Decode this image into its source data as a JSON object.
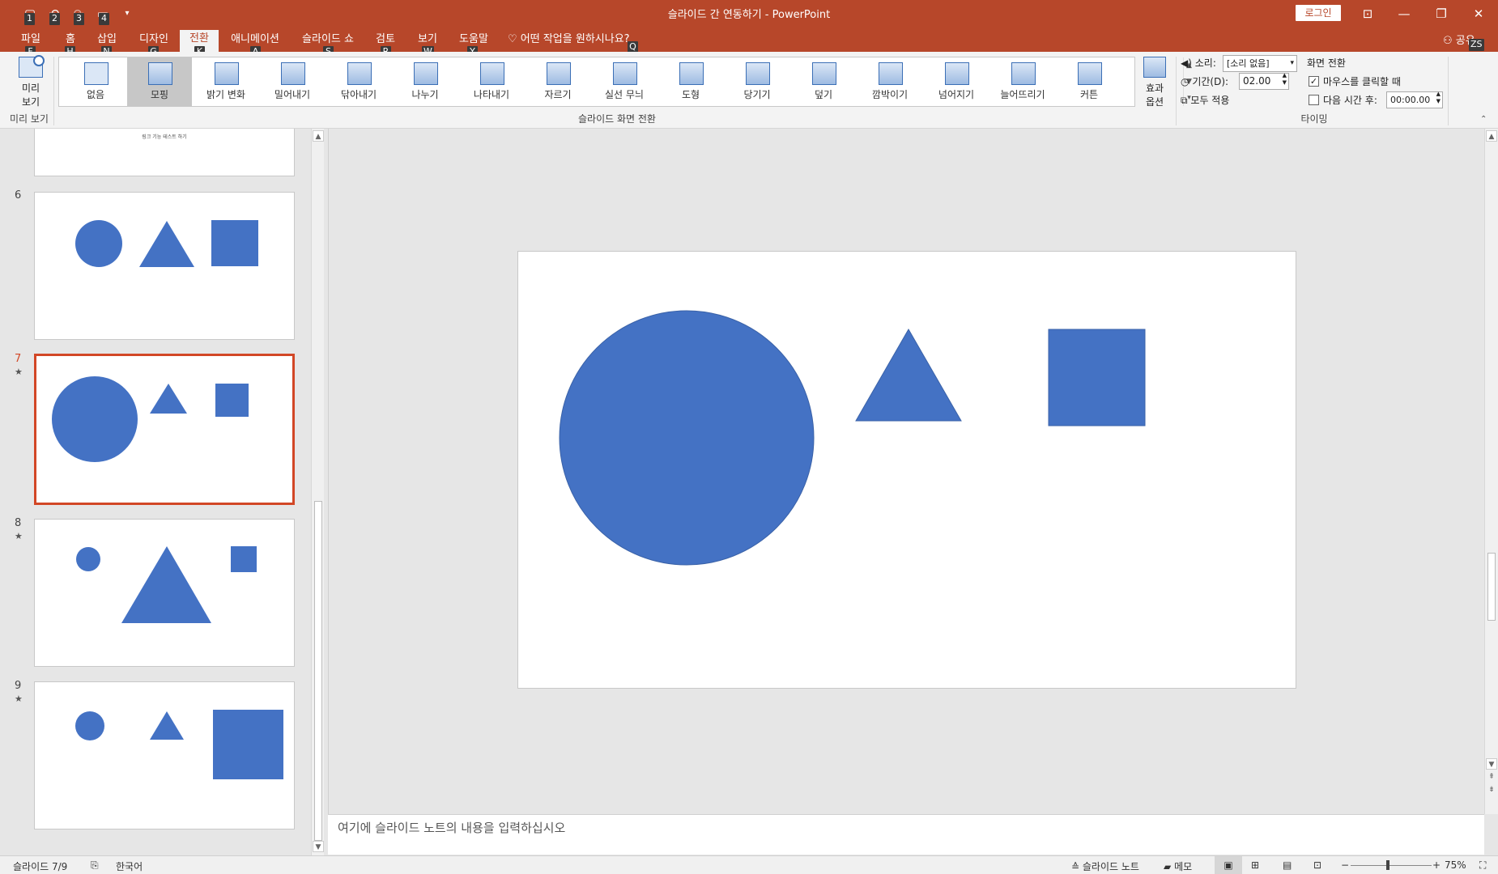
{
  "window": {
    "title": "슬라이드 간 연동하기 - PowerPoint",
    "login": "로그인"
  },
  "qat": {
    "keytips": [
      "1",
      "2",
      "3",
      "4"
    ]
  },
  "tabs": [
    {
      "label": "파일",
      "key": "F"
    },
    {
      "label": "홈",
      "key": "H"
    },
    {
      "label": "삽입",
      "key": "N"
    },
    {
      "label": "디자인",
      "key": "G"
    },
    {
      "label": "전환",
      "key": "K"
    },
    {
      "label": "애니메이션",
      "key": "A"
    },
    {
      "label": "슬라이드 쇼",
      "key": "S"
    },
    {
      "label": "검토",
      "key": "R"
    },
    {
      "label": "보기",
      "key": "W"
    },
    {
      "label": "도움말",
      "key": "Y"
    }
  ],
  "tellme": {
    "text": "어떤 작업을 원하시나요?",
    "key": "Q"
  },
  "share": {
    "label": "공유",
    "key": "ZS"
  },
  "ribbon": {
    "preview": {
      "line1": "미리",
      "line2": "보기",
      "group": "미리 보기"
    },
    "transitions": [
      "없음",
      "모핑",
      "밝기 변화",
      "밀어내기",
      "닦아내기",
      "나누기",
      "나타내기",
      "자르기",
      "실선 무늬",
      "도형",
      "당기기",
      "덮기",
      "깜박이기",
      "넘어지기",
      "늘어뜨리기",
      "커튼"
    ],
    "active_transition": "모핑",
    "effect_options": {
      "line1": "효과",
      "line2": "옵션"
    },
    "transition_group": "슬라이드 화면 전환",
    "timing": {
      "sound_label": "소리:",
      "sound_value": "[소리 없음]",
      "duration_label": "기간(D):",
      "duration_value": "02.00",
      "apply_all": "모두 적용",
      "advance_header": "화면 전환",
      "on_click": "마우스를 클릭할 때",
      "after": "다음 시간 후:",
      "after_value": "00:00.00",
      "group": "타이밍"
    }
  },
  "thumbnails": {
    "partial_text": "링크 기능 테스트 하기",
    "items": [
      {
        "num": "6",
        "star": ""
      },
      {
        "num": "7",
        "star": "★"
      },
      {
        "num": "8",
        "star": "★"
      },
      {
        "num": "9",
        "star": "★"
      }
    ]
  },
  "shape_color": "#4472c4",
  "accent": "#b7472a",
  "notes_placeholder": "여기에 슬라이드 노트의 내용을 입력하십시오",
  "status": {
    "slide": "슬라이드 7/9",
    "language": "한국어",
    "notes": "슬라이드 노트",
    "comments": "메모",
    "zoom": "75%"
  }
}
